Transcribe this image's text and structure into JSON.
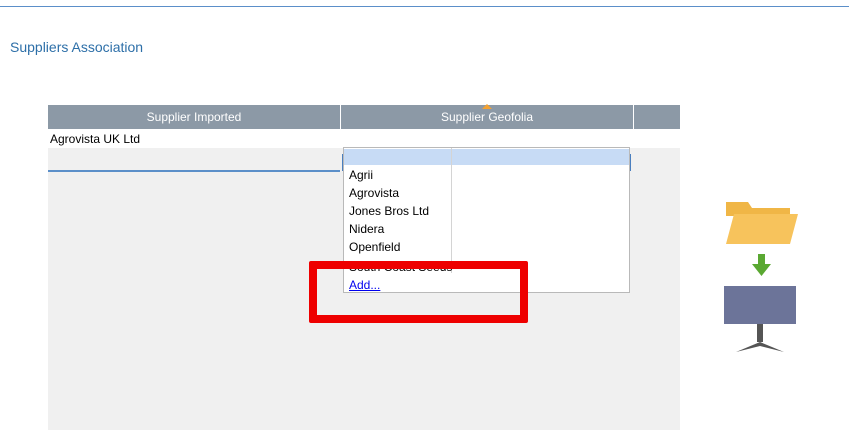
{
  "section": {
    "title": "Suppliers Association"
  },
  "grid": {
    "columns": [
      "Supplier Imported",
      "Supplier Geofolia"
    ],
    "rows": [
      {
        "supplier_imported": "Agrovista UK Ltd",
        "supplier_geofolia": ""
      }
    ]
  },
  "dropdown": {
    "items": [
      "",
      "Agrii",
      "Agrovista",
      "Jones Bros Ltd",
      "Nidera",
      "Openfield",
      "South Coast Seeds"
    ],
    "add_label": "Add..."
  },
  "colors": {
    "header_bg": "#8c99a6",
    "accent": "#5b8fc9",
    "highlight": "#ee0000",
    "folder": "#f7c35c",
    "arrow": "#5aa832",
    "monitor": "#6c7499"
  },
  "icons": [
    "folder-icon",
    "arrow-down-icon",
    "monitor-icon"
  ]
}
